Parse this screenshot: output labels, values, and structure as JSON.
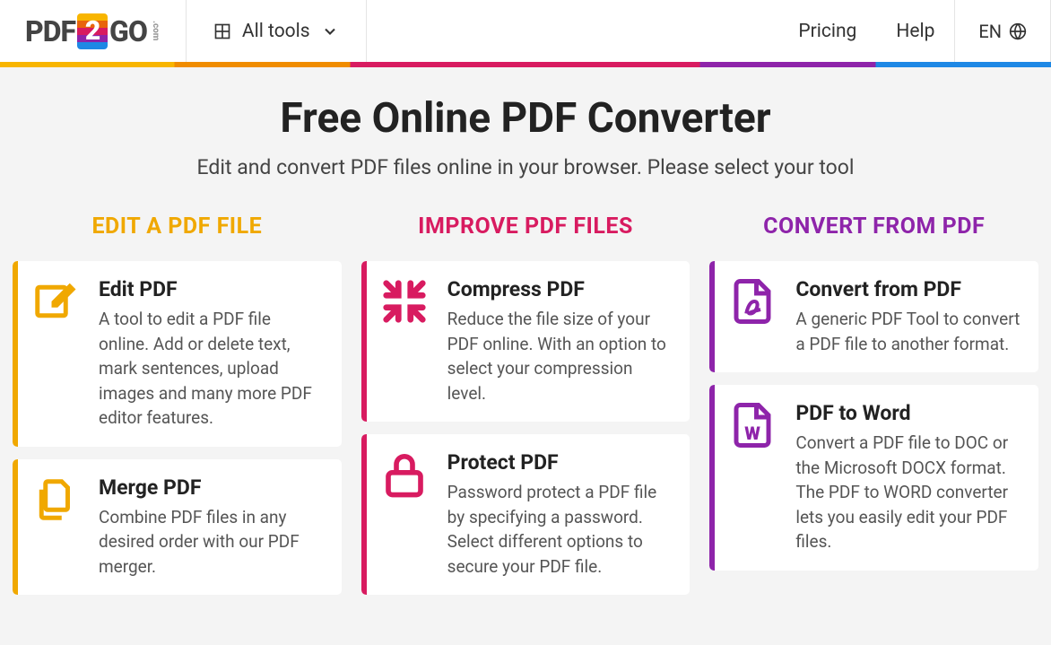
{
  "header": {
    "logo_pdf": "PDF",
    "logo_two": "2",
    "logo_go": "GO",
    "logo_com": ".com",
    "all_tools": "All tools",
    "pricing": "Pricing",
    "help": "Help",
    "lang": "EN"
  },
  "hero": {
    "title": "Free Online PDF Converter",
    "subtitle": "Edit and convert PDF files online in your browser. Please select your tool"
  },
  "columns": [
    {
      "id": "edit",
      "title": "EDIT A PDF FILE",
      "cards": [
        {
          "icon": "edit-icon",
          "title": "Edit PDF",
          "desc": "A tool to edit a PDF file online. Add or delete text, mark sentences, upload images and many more PDF editor features."
        },
        {
          "icon": "merge-icon",
          "title": "Merge PDF",
          "desc": "Combine PDF files in any desired order with our PDF merger."
        }
      ]
    },
    {
      "id": "improve",
      "title": "IMPROVE PDF FILES",
      "cards": [
        {
          "icon": "compress-icon",
          "title": "Compress PDF",
          "desc": "Reduce the file size of your PDF online. With an option to select your compression level."
        },
        {
          "icon": "lock-icon",
          "title": "Protect PDF",
          "desc": "Password protect a PDF file by specifying a password. Select different options to secure your PDF file."
        }
      ]
    },
    {
      "id": "convert",
      "title": "CONVERT FROM PDF",
      "cards": [
        {
          "icon": "pdf-icon",
          "title": "Convert from PDF",
          "desc": "A generic PDF Tool to convert a PDF file to another format."
        },
        {
          "icon": "word-icon",
          "title": "PDF to Word",
          "desc": "Convert a PDF file to DOC or the Microsoft DOCX format. The PDF to WORD converter lets you easily edit your PDF files."
        }
      ]
    }
  ]
}
